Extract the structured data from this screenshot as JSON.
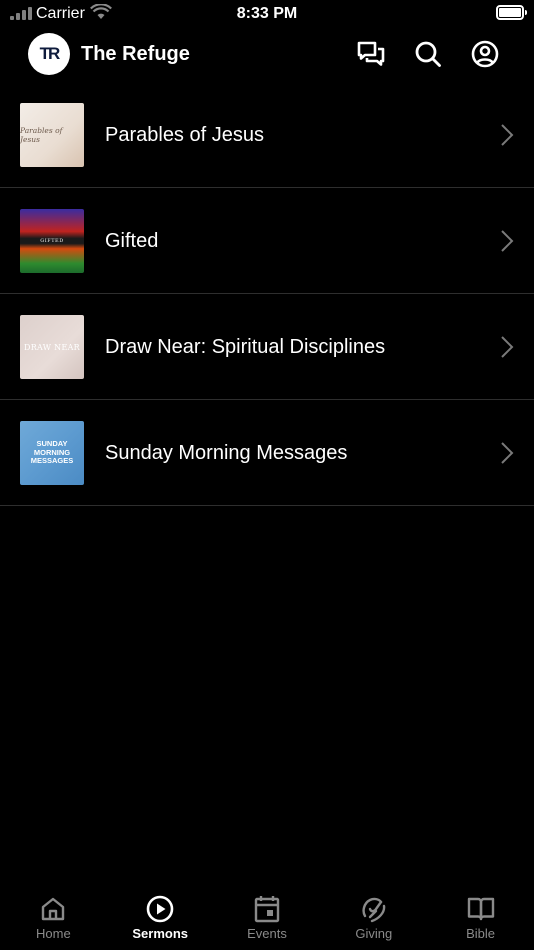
{
  "status_bar": {
    "carrier": "Carrier",
    "time": "8:33 PM"
  },
  "header": {
    "logo_text": "TR",
    "title": "The Refuge"
  },
  "sermon_series": [
    {
      "title": "Parables of Jesus",
      "thumb_text": "Parables of Jesus"
    },
    {
      "title": "Gifted",
      "thumb_text": "GIFTED"
    },
    {
      "title": "Draw Near: Spiritual Disciplines",
      "thumb_text": "DRAW NEAR"
    },
    {
      "title": "Sunday Morning Messages",
      "thumb_text": "SUNDAY MORNING MESSAGES"
    }
  ],
  "tabs": [
    {
      "label": "Home",
      "icon": "home-icon"
    },
    {
      "label": "Sermons",
      "icon": "play-circle-icon",
      "active": true
    },
    {
      "label": "Events",
      "icon": "calendar-icon"
    },
    {
      "label": "Giving",
      "icon": "giving-icon"
    },
    {
      "label": "Bible",
      "icon": "book-open-icon"
    }
  ],
  "colors": {
    "background": "#000000",
    "text": "#ffffff",
    "inactive_tab": "#8a8a8a",
    "divider": "#2e2e2e"
  }
}
